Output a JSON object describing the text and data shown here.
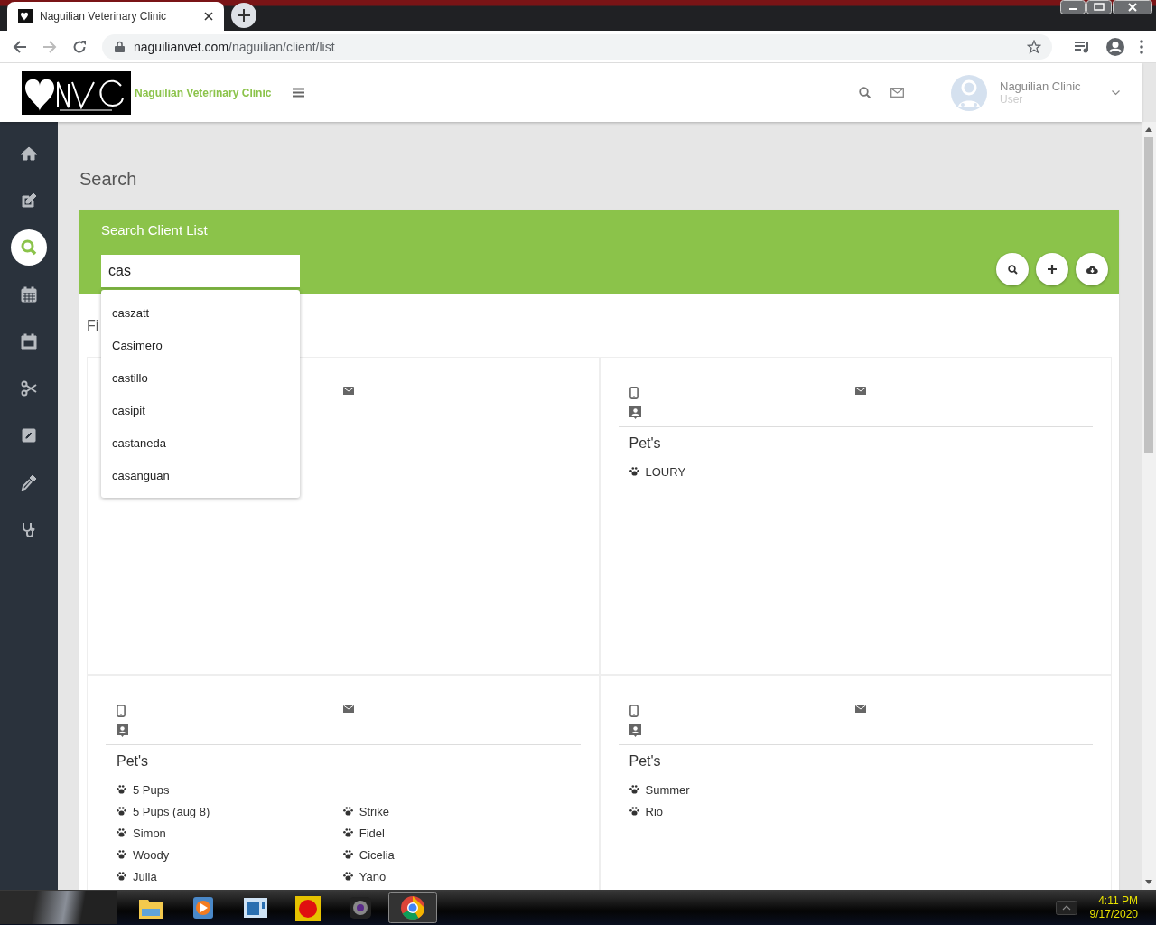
{
  "browser": {
    "tab": {
      "title": "Naguilian Veterinary Clinic"
    },
    "url": {
      "host": "naguilianvet.com",
      "path": "/naguilian/client/list"
    },
    "forward_disabled": true
  },
  "header": {
    "brand": "Naguilian Veterinary Clinic",
    "user": {
      "name": "Naguilian Clinic",
      "role": "User"
    }
  },
  "sidebar": {
    "items": [
      {
        "kind": "home",
        "selected": false
      },
      {
        "kind": "edit",
        "selected": false
      },
      {
        "kind": "search",
        "selected": true
      },
      {
        "kind": "calendar-grid",
        "selected": false
      },
      {
        "kind": "calendar",
        "selected": false
      },
      {
        "kind": "scissors",
        "selected": false
      },
      {
        "kind": "pencil-square",
        "selected": false
      },
      {
        "kind": "dropper",
        "selected": false
      },
      {
        "kind": "stethoscope",
        "selected": false
      }
    ]
  },
  "page": {
    "title": "Search"
  },
  "search_panel": {
    "title": "Search Client List",
    "query": "cas",
    "suggestions": [
      "caszatt",
      "Casimero",
      "castillo",
      "casipit",
      "castaneda",
      "casanguan"
    ],
    "buttons": [
      {
        "kind": "search"
      },
      {
        "kind": "plus"
      },
      {
        "kind": "cloud-download"
      }
    ]
  },
  "filter_label": "Fi",
  "clients": [
    {
      "icons": [
        {
          "kind": "mail"
        }
      ]
    },
    {
      "icons": [
        {
          "kind": "phone"
        },
        {
          "kind": "mail"
        },
        {
          "kind": "contact"
        }
      ],
      "pets_heading": "Pet's",
      "pet_rows": [
        {
          "col_1": "LOURY"
        }
      ]
    },
    {
      "icons": [
        {
          "kind": "phone"
        },
        {
          "kind": "mail"
        },
        {
          "kind": "contact"
        }
      ],
      "pets_heading": "Pet's",
      "pet_rows": [
        {
          "col_1": "5 Pups"
        },
        {
          "col_1": "5 Pups (aug 8)",
          "col_2": "Strike"
        },
        {
          "col_1": "Simon",
          "col_2": "Fidel"
        },
        {
          "col_1": "Woody",
          "col_2": "Cicelia"
        },
        {
          "col_1": "Julia",
          "col_2": "Yano"
        }
      ]
    },
    {
      "icons": [
        {
          "kind": "phone"
        },
        {
          "kind": "mail"
        },
        {
          "kind": "contact"
        }
      ],
      "pets_heading": "Pet's",
      "pet_rows": [
        {
          "col_1": "Summer"
        },
        {
          "col_1": "Rio"
        }
      ]
    }
  ],
  "taskbar": {
    "apps": [
      {
        "kind": "folder",
        "selected": false
      },
      {
        "kind": "media-player",
        "selected": false
      },
      {
        "kind": "window",
        "selected": false
      },
      {
        "kind": "record",
        "selected": false
      },
      {
        "kind": "camera",
        "selected": false
      },
      {
        "kind": "chrome",
        "selected": true
      }
    ],
    "time": "4:11 PM",
    "date": "9/17/2020"
  }
}
